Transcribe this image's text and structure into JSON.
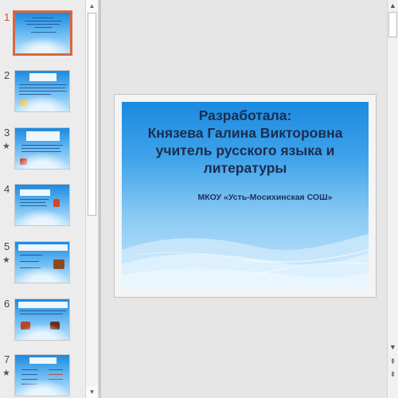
{
  "thumbnails": [
    {
      "number": "1",
      "starred": false,
      "active": true
    },
    {
      "number": "2",
      "starred": false,
      "active": false
    },
    {
      "number": "3",
      "starred": true,
      "active": false
    },
    {
      "number": "4",
      "starred": false,
      "active": false
    },
    {
      "number": "5",
      "starred": true,
      "active": false
    },
    {
      "number": "6",
      "starred": false,
      "active": false
    },
    {
      "number": "7",
      "starred": true,
      "active": false
    }
  ],
  "star_glyph": "★",
  "slide": {
    "title_lines": [
      "Разработала:",
      "Князева Галина Викторовна",
      "учитель русского языка и",
      "литературы"
    ],
    "subtitle": "МКОУ «Усть-Мосихинская СОШ»"
  },
  "colors": {
    "active_thumb_border": "#d9673e",
    "slide_title": "#1b2d4f"
  },
  "icons": {
    "scroll_up": "▲",
    "scroll_down": "▼",
    "prev_slide": "⇞",
    "next_slide": "⇟"
  }
}
